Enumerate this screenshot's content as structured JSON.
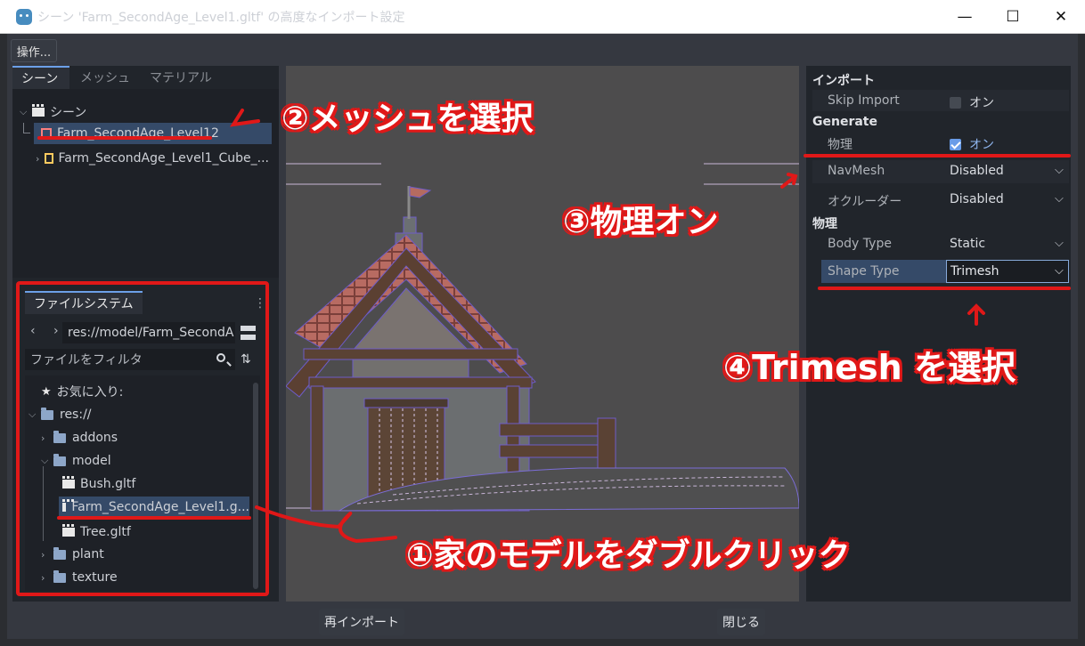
{
  "window": {
    "title": "シーン 'Farm_SecondAge_Level1.gltf' の高度なインポート設定",
    "minimize": "—",
    "maximize": "☐",
    "close": "✕"
  },
  "toolbar": {
    "actions_label": "操作..."
  },
  "scene_tabs": [
    "シーン",
    "メッシュ",
    "マテリアル"
  ],
  "scene_tree": {
    "root": "シーン",
    "items": [
      "Farm_SecondAge_Level12",
      "Farm_SecondAge_Level1_Cube_..."
    ]
  },
  "filesystem": {
    "tab": "ファイルシステム",
    "path": "res://model/Farm_SecondA",
    "filter_placeholder": "ファイルをフィルタ",
    "favorites": "お気に入り:",
    "res": "res://",
    "addons": "addons",
    "model": "model",
    "files": [
      "Bush.gltf",
      "Farm_SecondAge_Level1.g...",
      "Tree.gltf"
    ],
    "plant": "plant",
    "texture": "texture"
  },
  "inspector": {
    "import_section": "インポート",
    "skip_import_label": "Skip Import",
    "skip_import_value": "オン",
    "generate_section": "Generate",
    "physics_label": "物理",
    "physics_value": "オン",
    "navmesh_label": "NavMesh",
    "navmesh_value": "Disabled",
    "occluder_label": "オクルーダー",
    "occluder_value": "Disabled",
    "physics_section": "物理",
    "body_type_label": "Body Type",
    "body_type_value": "Static",
    "shape_type_label": "Shape Type",
    "shape_type_value": "Trimesh"
  },
  "buttons": {
    "reimport": "再インポート",
    "close": "閉じる"
  },
  "annotations": {
    "step1": "①家のモデルをダブルクリック",
    "step2": "②メッシュを選択",
    "step3": "③物理オン",
    "step4": "④Trimesh を選択"
  },
  "colors": {
    "accent": "#699ce8",
    "annotation": "#e01818",
    "selection": "#354a68"
  }
}
